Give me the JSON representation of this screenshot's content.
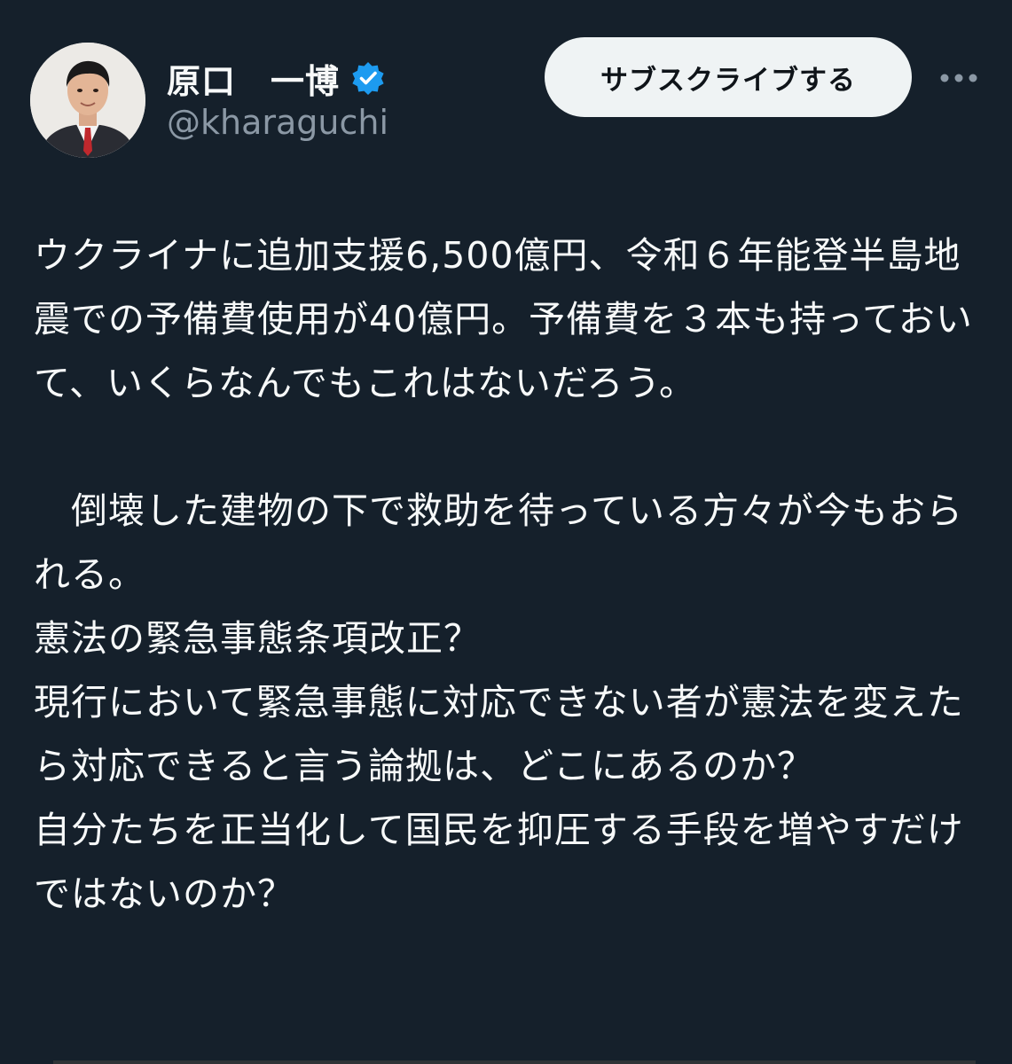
{
  "author": {
    "display_name": "原口　一博",
    "handle": "@kharaguchi",
    "verified_icon": "verified-badge-icon",
    "avatar_icon": "avatar-photo"
  },
  "actions": {
    "subscribe_label": "サブスクライブする",
    "more_icon": "more-horizontal-icon"
  },
  "tweet": {
    "text": "ウクライナに追加支援6,500億円、令和６年能登半島地震での予備費使用が40億円。予備費を３本も持っておいて、いくらなんでもこれはないだろう。\n\n　倒壊した建物の下で救助を待っている方々が今もおられる。\n憲法の緊急事態条項改正？\n現行において緊急事態に対応できない者が憲法を変えたら対応できると言う論拠は、どこにあるのか？\n自分たちを正当化して国民を抑圧する手段を増やすだけではないのか？"
  },
  "colors": {
    "background": "#15202b",
    "text": "#f7f9f9",
    "secondary_text": "#8b98a5",
    "verified": "#1d9bf0",
    "button_bg": "#eff3f4"
  }
}
